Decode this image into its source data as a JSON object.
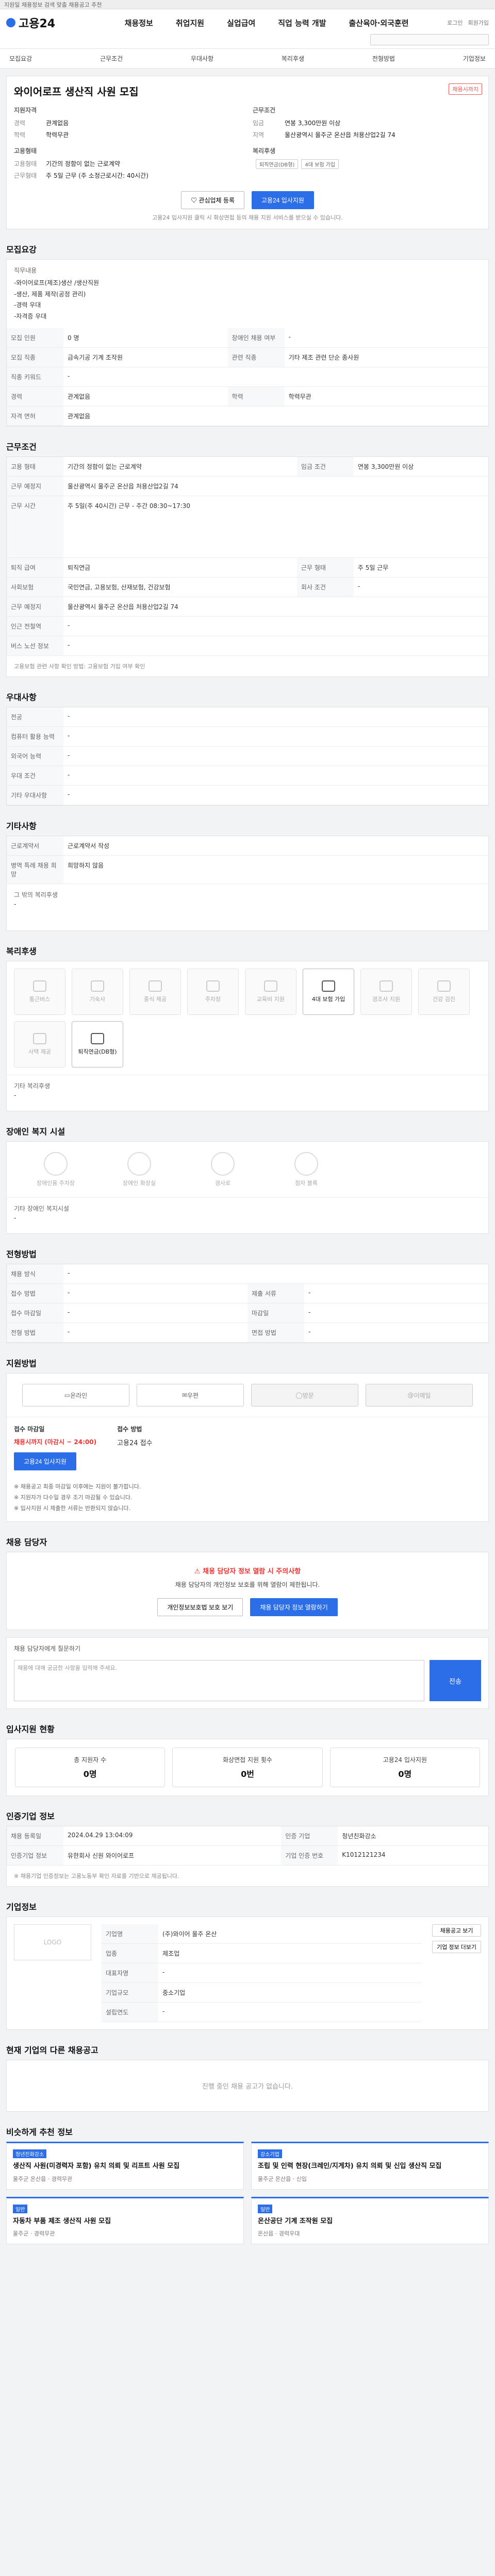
{
  "topbar": {
    "text": "지원일 채용정보 검색 맞춤 채용공고 추천"
  },
  "header": {
    "logo": "고용24",
    "nav": [
      "채용정보",
      "취업지원",
      "실업급여",
      "직업 능력 개발",
      "출산육아·외국훈련"
    ],
    "util": [
      "로그인",
      "회원가입"
    ]
  },
  "subnav": [
    "모집요강",
    "근무조건",
    "우대사항",
    "복리후생",
    "전형방법",
    "기업정보"
  ],
  "job": {
    "title": "와이어로프 생산직 사원 모집",
    "status_tag": "채용시까지",
    "left_heading": "지원자격",
    "left": [
      {
        "k": "경력",
        "v": "관계없음"
      },
      {
        "k": "학력",
        "v": "학력무관"
      }
    ],
    "left2_heading": "고용형태",
    "left2": [
      {
        "k": "고용형태",
        "v": "기간의 정함이 없는 근로계약"
      },
      {
        "k": "근무형태",
        "v": "주 5일 근무 (주 소정근로시간: 40시간)"
      }
    ],
    "right_heading": "근무조건",
    "right": [
      {
        "k": "임금",
        "v": "연봉 3,300만원 이상"
      },
      {
        "k": "지역",
        "v": "울산광역시 울주군 온산읍 처용산업2길 74"
      }
    ],
    "right2_heading": "복리후생",
    "right2": [
      "퇴직연금(DB형)",
      "4대 보험 가입"
    ],
    "interest_btn": "관심업체 등록",
    "apply_btn": "고용24 입사지원",
    "apply_note": "고용24 입사지원 클릭 시 화상면접 등의 채용 지원 서비스를 받으실 수 있습니다."
  },
  "recruit": {
    "title": "모집요강",
    "job_desc_label": "직무내용",
    "job_desc": "-와이어로프(제조)생산 /생산직원 \n-생산, 제품 제작(공정 관리) \n-경력 우대 \n-자격증 우대",
    "rows": [
      {
        "k": "모집 인원",
        "v": "0 명",
        "k2": "장애인 채용 여부",
        "v2": "-"
      },
      {
        "k": "모집 직종",
        "v": "금속기공 기계 조작원",
        "k2": "관련 직종",
        "v2": "기타 제조 관련 단순 종사원"
      },
      {
        "k": "직종 키워드",
        "v": "-",
        "k2": "",
        "v2": ""
      },
      {
        "k": "경력",
        "v": "관계없음",
        "k2": "학력",
        "v2": "학력무관"
      },
      {
        "k": "자격 면허",
        "v": "관계없음",
        "k2": "",
        "v2": ""
      }
    ]
  },
  "work": {
    "title": "근무조건",
    "rows": [
      {
        "k": "고용 형태",
        "v": "기간의 정함이 없는 근로계약",
        "k2": "임금 조건",
        "v2": "연봉 3,300만원 이상"
      },
      {
        "k": "근무 예정지",
        "v": "울산광역시 울주군 온산읍 처용산업2길 74",
        "k2": "",
        "v2": ""
      },
      {
        "k": "근무 시간",
        "v": "주 5일(주 40시간) 근무 - 주간 08:30~17:30",
        "k2": "",
        "v2": ""
      },
      {
        "k": "퇴직 급여",
        "v": "퇴직연금",
        "k2": "근무 형태",
        "v2": "주 5일 근무"
      },
      {
        "k": "사회보험",
        "v": "국민연금, 고용보험, 산재보험, 건강보험",
        "k2": "회사 조건",
        "v2": "-"
      },
      {
        "k": "근무 예정지",
        "v": "울산광역시 울주군 온산읍 처용산업2길 74",
        "k2": "",
        "v2": ""
      },
      {
        "k": "인근 전철역",
        "v": "-",
        "k2": "",
        "v2": ""
      },
      {
        "k": "버스 노선 정보",
        "v": "-",
        "k2": "",
        "v2": ""
      }
    ],
    "footnote": "고용보험 관련 사항 확인 방법: 고용보험 가입 여부 확인"
  },
  "prefer": {
    "title": "우대사항",
    "rows": [
      {
        "k": "전공",
        "v": "-"
      },
      {
        "k": "컴퓨터 활용 능력",
        "v": "-"
      },
      {
        "k": "외국어 능력",
        "v": "-"
      },
      {
        "k": "우대 조건",
        "v": "-"
      },
      {
        "k": "기타 우대사항",
        "v": "-"
      }
    ]
  },
  "etc": {
    "title": "기타사항",
    "rows": [
      {
        "k": "근로계약서",
        "v": "근로계약서 작성"
      },
      {
        "k": "병역 특례 채용 희망",
        "v": "희망하지 않음"
      }
    ],
    "extra_label": "그 밖의 복리후생",
    "extra": "-"
  },
  "benefit": {
    "title": "복리후생",
    "items": [
      {
        "label": "통근버스",
        "on": false
      },
      {
        "label": "기숙사",
        "on": false
      },
      {
        "label": "중식 제공",
        "on": false
      },
      {
        "label": "주차장",
        "on": false
      },
      {
        "label": "교육비 지원",
        "on": false
      },
      {
        "label": "4대 보험 가입",
        "on": true
      },
      {
        "label": "경조사 지원",
        "on": false
      },
      {
        "label": "건강 검진",
        "on": false
      },
      {
        "label": "사택 제공",
        "on": false
      },
      {
        "label": "퇴직연금(DB형)",
        "on": true
      }
    ],
    "extra_label": "기타 복리후생",
    "extra": "-"
  },
  "disabled": {
    "title": "장애인 복지 시설",
    "items": [
      "장애인용 주차장",
      "장애인 화장실",
      "경사로",
      "점자 블록"
    ],
    "extra_label": "기타 장애인 복지시설",
    "extra": "-"
  },
  "screening": {
    "title": "전형방법",
    "rows": [
      {
        "k": "채용 방식",
        "v": "-"
      },
      {
        "k": "접수 방법",
        "v": "-",
        "k2": "제출 서류",
        "v2": "-"
      },
      {
        "k": "접수 마감일",
        "v": "-",
        "k2": "마감일",
        "v2": "-"
      },
      {
        "k": "전형 방법",
        "v": "-",
        "k2": "면접 방법",
        "v2": "-"
      }
    ]
  },
  "support": {
    "title": "지원방법",
    "items": [
      {
        "label": "온라인",
        "on": true
      },
      {
        "label": "우편",
        "on": true
      },
      {
        "label": "방문",
        "on": false
      },
      {
        "label": "이메일",
        "on": false
      }
    ],
    "apply_label": "접수 마감일",
    "apply_value": "채용시까지 (마감시 ~ 24:00)",
    "process_label": "접수 방법",
    "process_value": "고용24 접수",
    "apply_btn": "고용24 입사지원",
    "notices": [
      "※ 채용공고 최종 마감일 이후에는 지원이 불가합니다.",
      "※ 지원자가 다수일 경우 조기 마감될 수 있습니다.",
      "※ 입사지원 시 제출한 서류는 반환되지 않습니다."
    ]
  },
  "contact": {
    "title": "채용 담당자",
    "warn": "채용 담당자 정보 열람 시 주의사항",
    "text": "채용 담당자의 개인정보 보호를 위해 열람이 제한됩니다.",
    "btn1": "개인정보보호법 보호 보기",
    "btn2": "채용 담당자 정보 열람하기",
    "qa_label": "채용 담당자에게 질문하기",
    "qa_placeholder": "채용에 대해 궁금한 사항을 입력해 주세요.",
    "qa_btn": "전송"
  },
  "stats": {
    "title": "입사지원 현황",
    "items": [
      {
        "label": "총 지원자 수",
        "value": "0명"
      },
      {
        "label": "화상면접 지원 횟수",
        "value": "0번"
      },
      {
        "label": "고용24 입사지원",
        "value": "0명"
      }
    ]
  },
  "company_info": {
    "title": "인증기업 정보",
    "rows": [
      {
        "k": "채용 등록일",
        "v": "2024.04.29 13:04:09",
        "k2": "인증 기업",
        "v2": "청년친화강소"
      },
      {
        "k": "인증기업 정보",
        "v": "유한회사 신원 와이어로프",
        "k2": "기업 인증 번호",
        "v2": "K1012121234"
      }
    ],
    "notice": "※ 채용기업 인증정보는 고용노동부 확인 자료를 기반으로 제공됩니다."
  },
  "company": {
    "title": "기업정보",
    "logo_placeholder": "LOGO",
    "rows": [
      {
        "k": "기업명",
        "v": "(주)와이어 울주 온산"
      },
      {
        "k": "업종",
        "v": "제조업"
      },
      {
        "k": "대표자명",
        "v": "-"
      },
      {
        "k": "기업규모",
        "v": "중소기업"
      },
      {
        "k": "설립연도",
        "v": "-"
      }
    ],
    "btn": "채용공고 보기",
    "btn2": "기업 정보 더보기"
  },
  "same_company": {
    "title": "현재 기업의 다른 채용공고",
    "empty": "진행 중인 채용 공고가 없습니다."
  },
  "recommend": {
    "title": "비슷하게 추천 정보",
    "items": [
      {
        "badge": "청년친화강소",
        "title": "생산직 사원(미경력자 포함) 유치 의뢰 및 리프트 사원 모집",
        "meta": "울주군 온산읍 · 경력무관"
      },
      {
        "badge": "강소기업",
        "title": "조립 및 인력 현장(크레인/지게차) 유치 의뢰 및 신입 생산직 모집",
        "meta": "울주군 온산읍 · 신입"
      },
      {
        "badge": "일반",
        "title": "자동차 부품 제조 생산직 사원 모집",
        "meta": "울주군 · 경력무관"
      },
      {
        "badge": "일반",
        "title": "온산공단 기계 조작원 모집",
        "meta": "온산읍 · 경력우대"
      }
    ]
  }
}
